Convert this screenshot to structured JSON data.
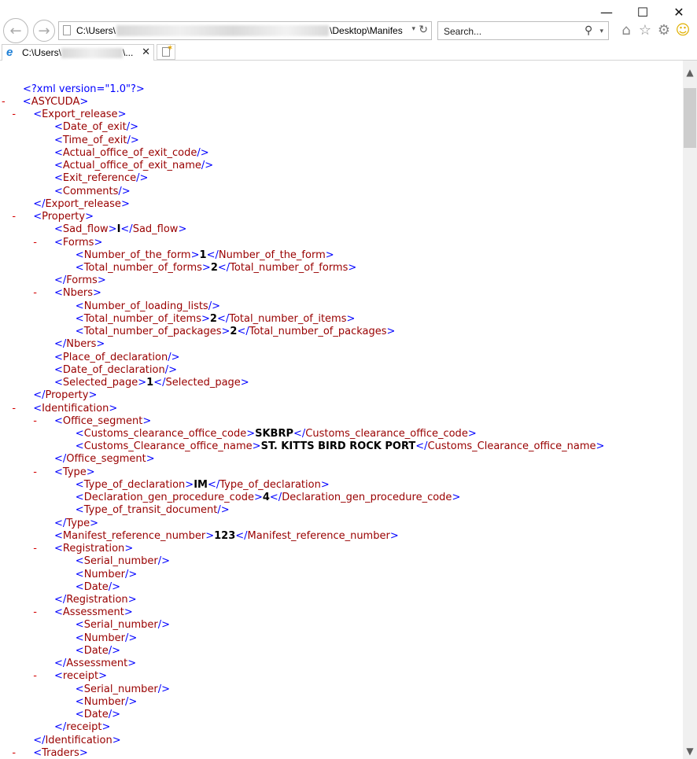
{
  "window": {
    "controls": {
      "minimize": "—",
      "maximize": "☐",
      "close": "✕"
    }
  },
  "address_bar": {
    "prefix": "C:\\Users\\",
    "suffix": "\\Desktop\\Manifes",
    "dropdown": "▾",
    "refresh": "↻"
  },
  "search": {
    "placeholder": "Search...",
    "dropdown": "▾",
    "icon": "search-icon"
  },
  "toolbar_icons": [
    "home-icon",
    "favorites-star-icon",
    "settings-gear-icon",
    "feedback-smiley-icon"
  ],
  "tab": {
    "prefix": "C:\\Users\\",
    "suffix": "\\...",
    "close": "✕"
  },
  "xml": {
    "declaration": "<?xml version=\"1.0\"?>",
    "lines": [
      {
        "i": 2,
        "m": true,
        "tag": "ASYCUDA",
        "kind": "open"
      },
      {
        "i": 3,
        "m": true,
        "tag": "Export_release",
        "kind": "open"
      },
      {
        "i": 5,
        "tag": "Date_of_exit",
        "kind": "empty"
      },
      {
        "i": 5,
        "tag": "Time_of_exit",
        "kind": "empty"
      },
      {
        "i": 5,
        "tag": "Actual_office_of_exit_code",
        "kind": "empty"
      },
      {
        "i": 5,
        "tag": "Actual_office_of_exit_name",
        "kind": "empty"
      },
      {
        "i": 5,
        "tag": "Exit_reference",
        "kind": "empty"
      },
      {
        "i": 5,
        "tag": "Comments",
        "kind": "empty"
      },
      {
        "i": 3,
        "tag": "Export_release",
        "kind": "close"
      },
      {
        "i": 3,
        "m": true,
        "tag": "Property",
        "kind": "open"
      },
      {
        "i": 5,
        "tag": "Sad_flow",
        "kind": "value",
        "value": "I"
      },
      {
        "i": 5,
        "m": true,
        "tag": "Forms",
        "kind": "open"
      },
      {
        "i": 7,
        "tag": "Number_of_the_form",
        "kind": "value",
        "value": "1"
      },
      {
        "i": 7,
        "tag": "Total_number_of_forms",
        "kind": "value",
        "value": "2"
      },
      {
        "i": 5,
        "tag": "Forms",
        "kind": "close"
      },
      {
        "i": 5,
        "m": true,
        "tag": "Nbers",
        "kind": "open"
      },
      {
        "i": 7,
        "tag": "Number_of_loading_lists",
        "kind": "empty"
      },
      {
        "i": 7,
        "tag": "Total_number_of_items",
        "kind": "value",
        "value": "2"
      },
      {
        "i": 7,
        "tag": "Total_number_of_packages",
        "kind": "value",
        "value": "2"
      },
      {
        "i": 5,
        "tag": "Nbers",
        "kind": "close"
      },
      {
        "i": 5,
        "tag": "Place_of_declaration",
        "kind": "empty"
      },
      {
        "i": 5,
        "tag": "Date_of_declaration",
        "kind": "empty"
      },
      {
        "i": 5,
        "tag": "Selected_page",
        "kind": "value",
        "value": "1"
      },
      {
        "i": 3,
        "tag": "Property",
        "kind": "close"
      },
      {
        "i": 3,
        "m": true,
        "tag": "Identification",
        "kind": "open"
      },
      {
        "i": 5,
        "m": true,
        "tag": "Office_segment",
        "kind": "open"
      },
      {
        "i": 7,
        "tag": "Customs_clearance_office_code",
        "kind": "value",
        "value": "SKBRP"
      },
      {
        "i": 7,
        "tag": "Customs_Clearance_office_name",
        "kind": "value",
        "value": "ST. KITTS BIRD ROCK PORT"
      },
      {
        "i": 5,
        "tag": "Office_segment",
        "kind": "close"
      },
      {
        "i": 5,
        "m": true,
        "tag": "Type",
        "kind": "open"
      },
      {
        "i": 7,
        "tag": "Type_of_declaration",
        "kind": "value",
        "value": "IM"
      },
      {
        "i": 7,
        "tag": "Declaration_gen_procedure_code",
        "kind": "value",
        "value": "4"
      },
      {
        "i": 7,
        "tag": "Type_of_transit_document",
        "kind": "empty"
      },
      {
        "i": 5,
        "tag": "Type",
        "kind": "close"
      },
      {
        "i": 5,
        "tag": "Manifest_reference_number",
        "kind": "value",
        "value": "123"
      },
      {
        "i": 5,
        "m": true,
        "tag": "Registration",
        "kind": "open"
      },
      {
        "i": 7,
        "tag": "Serial_number",
        "kind": "empty"
      },
      {
        "i": 7,
        "tag": "Number",
        "kind": "empty"
      },
      {
        "i": 7,
        "tag": "Date",
        "kind": "empty"
      },
      {
        "i": 5,
        "tag": "Registration",
        "kind": "close"
      },
      {
        "i": 5,
        "m": true,
        "tag": "Assessment",
        "kind": "open"
      },
      {
        "i": 7,
        "tag": "Serial_number",
        "kind": "empty"
      },
      {
        "i": 7,
        "tag": "Number",
        "kind": "empty"
      },
      {
        "i": 7,
        "tag": "Date",
        "kind": "empty"
      },
      {
        "i": 5,
        "tag": "Assessment",
        "kind": "close"
      },
      {
        "i": 5,
        "m": true,
        "tag": "receipt",
        "kind": "open"
      },
      {
        "i": 7,
        "tag": "Serial_number",
        "kind": "empty"
      },
      {
        "i": 7,
        "tag": "Number",
        "kind": "empty"
      },
      {
        "i": 7,
        "tag": "Date",
        "kind": "empty"
      },
      {
        "i": 5,
        "tag": "receipt",
        "kind": "close"
      },
      {
        "i": 3,
        "tag": "Identification",
        "kind": "close"
      },
      {
        "i": 3,
        "m": true,
        "tag": "Traders",
        "kind": "open"
      }
    ]
  },
  "colors": {
    "bracket": "#0000ff",
    "tag_name": "#990000",
    "collapse_minus": "#d40000",
    "value": "#000000"
  }
}
